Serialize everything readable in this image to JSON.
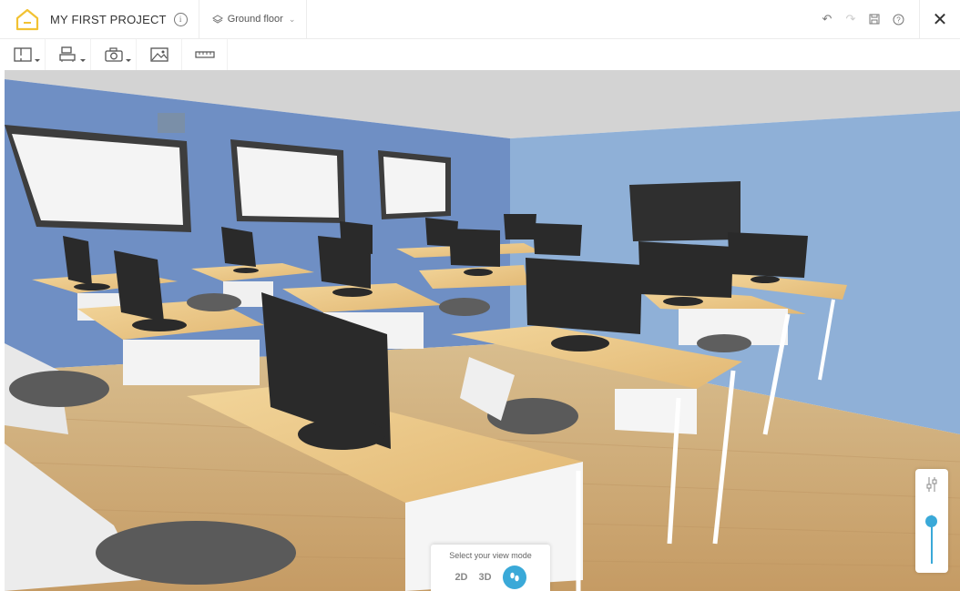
{
  "header": {
    "project_title": "MY FIRST PROJECT",
    "floor_label": "Ground floor",
    "brand_color": "#f2c233"
  },
  "toolbar": {
    "tools": [
      "floorplan-icon",
      "furniture-icon",
      "camera-icon",
      "image-icon",
      "ruler-icon"
    ]
  },
  "view_mode": {
    "title": "Select your view mode",
    "option_2d": "2D",
    "option_3d": "3D",
    "active": "walkthrough",
    "accent": "#3aa9d8"
  },
  "zoom": {
    "level": 0.55
  }
}
